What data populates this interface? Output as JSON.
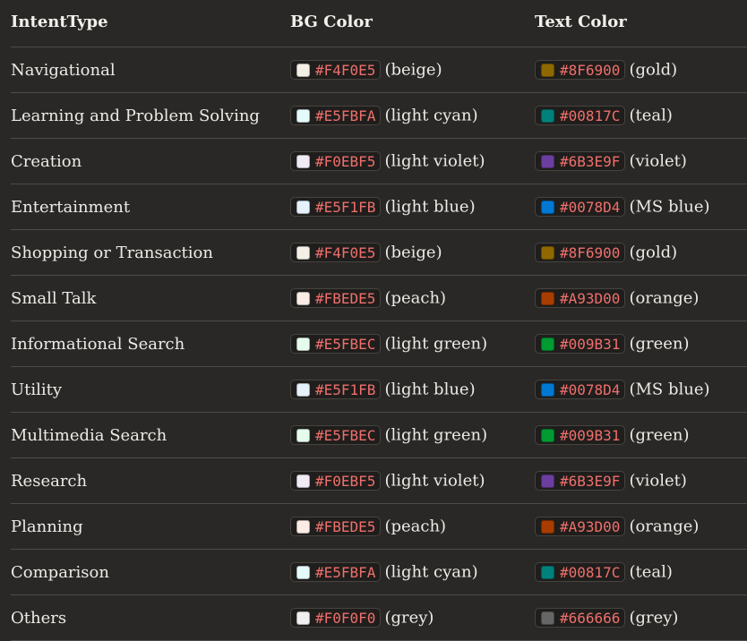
{
  "table": {
    "headers": [
      "IntentType",
      "BG Color",
      "Text Color"
    ],
    "rows": [
      {
        "intent": "Navigational",
        "bg": {
          "hex": "#F4F0E5",
          "note": "(beige)"
        },
        "text": {
          "hex": "#8F6900",
          "note": "(gold)"
        }
      },
      {
        "intent": "Learning and Problem Solving",
        "bg": {
          "hex": "#E5FBFA",
          "note": "(light cyan)"
        },
        "text": {
          "hex": "#00817C",
          "note": "(teal)"
        }
      },
      {
        "intent": "Creation",
        "bg": {
          "hex": "#F0EBF5",
          "note": "(light violet)"
        },
        "text": {
          "hex": "#6B3E9F",
          "note": "(violet)"
        }
      },
      {
        "intent": "Entertainment",
        "bg": {
          "hex": "#E5F1FB",
          "note": "(light blue)"
        },
        "text": {
          "hex": "#0078D4",
          "note": "(MS blue)"
        }
      },
      {
        "intent": "Shopping or Transaction",
        "bg": {
          "hex": "#F4F0E5",
          "note": "(beige)"
        },
        "text": {
          "hex": "#8F6900",
          "note": "(gold)"
        }
      },
      {
        "intent": "Small Talk",
        "bg": {
          "hex": "#FBEDE5",
          "note": "(peach)"
        },
        "text": {
          "hex": "#A93D00",
          "note": "(orange)"
        }
      },
      {
        "intent": "Informational Search",
        "bg": {
          "hex": "#E5FBEC",
          "note": "(light green)"
        },
        "text": {
          "hex": "#009B31",
          "note": "(green)"
        }
      },
      {
        "intent": "Utility",
        "bg": {
          "hex": "#E5F1FB",
          "note": "(light blue)"
        },
        "text": {
          "hex": "#0078D4",
          "note": "(MS blue)"
        }
      },
      {
        "intent": "Multimedia Search",
        "bg": {
          "hex": "#E5FBEC",
          "note": "(light green)"
        },
        "text": {
          "hex": "#009B31",
          "note": "(green)"
        }
      },
      {
        "intent": "Research",
        "bg": {
          "hex": "#F0EBF5",
          "note": "(light violet)"
        },
        "text": {
          "hex": "#6B3E9F",
          "note": "(violet)"
        }
      },
      {
        "intent": "Planning",
        "bg": {
          "hex": "#FBEDE5",
          "note": "(peach)"
        },
        "text": {
          "hex": "#A93D00",
          "note": "(orange)"
        }
      },
      {
        "intent": "Comparison",
        "bg": {
          "hex": "#E5FBFA",
          "note": "(light cyan)"
        },
        "text": {
          "hex": "#00817C",
          "note": "(teal)"
        }
      },
      {
        "intent": "Others",
        "bg": {
          "hex": "#F0F0F0",
          "note": "(grey)"
        },
        "text": {
          "hex": "#666666",
          "note": "(grey)"
        }
      }
    ]
  }
}
